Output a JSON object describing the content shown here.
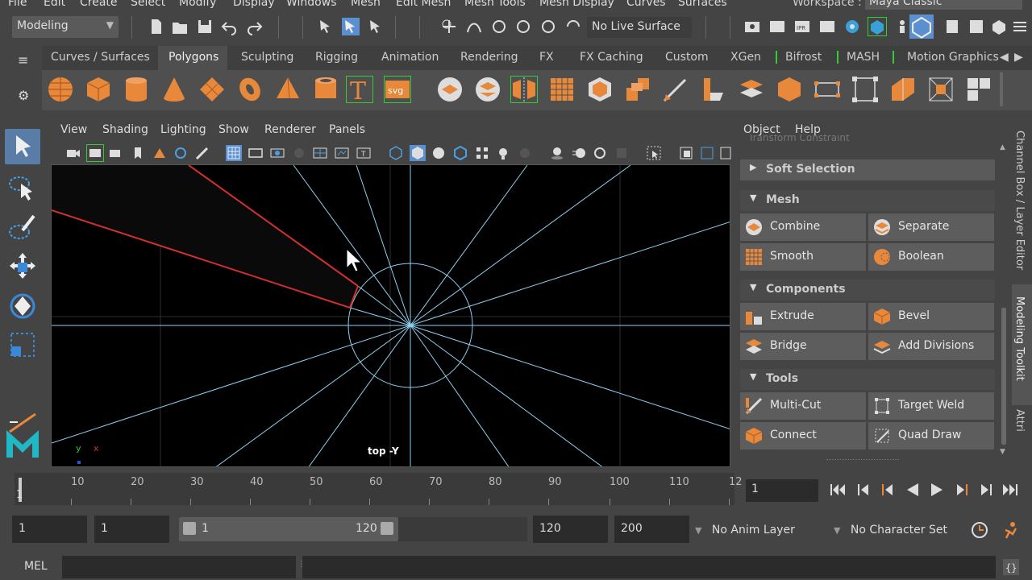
{
  "menubar": {
    "items": [
      "File",
      "Edit",
      "Create",
      "Select",
      "Modify",
      "Display",
      "Windows",
      "Mesh",
      "Edit Mesh",
      "Mesh Tools",
      "Mesh Display",
      "Curves",
      "Surfaces"
    ],
    "workspace_label": "Workspace :",
    "workspace_value": "Maya Classic"
  },
  "statusline": {
    "mode": "Modeling",
    "live_surface": "No Live Surface"
  },
  "shelf": {
    "tabs": [
      "Curves / Surfaces",
      "Polygons",
      "Sculpting",
      "Rigging",
      "Animation",
      "Rendering",
      "FX",
      "FX Caching",
      "Custom",
      "XGen",
      "Bifrost",
      "MASH",
      "Motion Graphics"
    ],
    "active_tab": "Polygons",
    "icons": [
      "sphere-icon",
      "cube-icon",
      "cylinder-icon",
      "cone-icon",
      "plane-icon",
      "torus-icon",
      "pyramid-icon",
      "pipe-icon",
      "type-icon",
      "svg-icon",
      "combine-icon",
      "separate-icon",
      "mirror-icon",
      "smooth-icon",
      "bevel-icon",
      "extrude-icon",
      "multi-cut-icon",
      "bridge-icon",
      "target-weld-icon",
      "add-divisions-icon",
      "quad-draw-icon",
      "uv-icon",
      "planar-icon",
      "automatic-icon",
      "cut-uv-icon",
      "sew-uv-icon"
    ]
  },
  "viewport": {
    "menu": [
      "View",
      "Shading",
      "Lighting",
      "Show",
      "Renderer",
      "Panels"
    ],
    "camera_label": "top -Y",
    "axis_y": "y",
    "axis_x": "x"
  },
  "right_panel": {
    "menu": [
      "Object",
      "Help"
    ],
    "partial_text": "Transform Constraint",
    "sections": {
      "soft_selection": "Soft Selection",
      "mesh": "Mesh",
      "components": "Components",
      "tools": "Tools"
    },
    "mesh_buttons": [
      "Combine",
      "Separate",
      "Smooth",
      "Boolean"
    ],
    "component_buttons": [
      "Extrude",
      "Bevel",
      "Bridge",
      "Add Divisions"
    ],
    "tool_buttons": [
      "Multi-Cut",
      "Target Weld",
      "Connect",
      "Quad Draw"
    ],
    "side_tabs": [
      "Channel Box / Layer Editor",
      "Modeling Toolkit",
      "Attri"
    ]
  },
  "timeline": {
    "ticks": [
      "10",
      "20",
      "30",
      "40",
      "50",
      "60",
      "70",
      "80",
      "90",
      "100",
      "110",
      "12"
    ],
    "current_frame_marker": "1",
    "current_frame": "1"
  },
  "range": {
    "start": "1",
    "playback_start": "1",
    "slider_start": "1",
    "slider_end": "120",
    "playback_end": "120",
    "end": "200",
    "anim_layer": "No Anim Layer",
    "character_set": "No Character Set"
  },
  "cmdline": {
    "label": "MEL"
  },
  "colors": {
    "accent_orange": "#e8883a",
    "highlight_blue": "#5a8fd0",
    "wire_blue": "#8ed0f0",
    "edge_red": "#d03030",
    "bg": "#444444"
  }
}
